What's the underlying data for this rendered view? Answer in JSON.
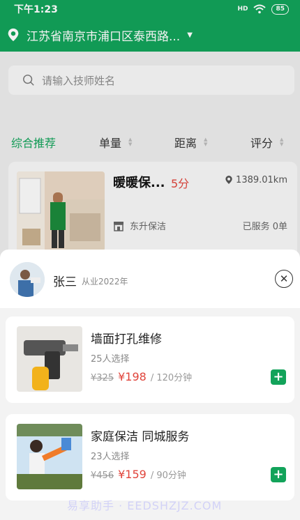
{
  "status_bar": {
    "time": "下午1:23",
    "signal": "HD",
    "battery": "85"
  },
  "location": {
    "text": "江苏省南京市浦口区泰西路..."
  },
  "search": {
    "placeholder": "请输入技师姓名"
  },
  "filters": [
    {
      "label": "综合推荐",
      "active": true
    },
    {
      "label": "单量"
    },
    {
      "label": "距离"
    },
    {
      "label": "评分"
    }
  ],
  "provider_card": {
    "name": "暖暖保...",
    "score": "5分",
    "distance": "1389.01km",
    "company": "东升保洁",
    "served": "已服务 0单"
  },
  "technician": {
    "name": "张三",
    "years": "从业2022年"
  },
  "services": [
    {
      "title": "墙面打孔维修",
      "count": "25人选择",
      "old_price": "¥325",
      "new_price": "¥198",
      "duration": "/ 120分钟"
    },
    {
      "title": "家庭保洁 同城服务",
      "count": "23人选择",
      "old_price": "¥456",
      "new_price": "¥159",
      "duration": "/ 90分钟"
    }
  ],
  "watermark": "易享助手 · EEDSHZJZ.COM",
  "colors": {
    "accent": "#12a35a",
    "price": "#e0443b"
  }
}
